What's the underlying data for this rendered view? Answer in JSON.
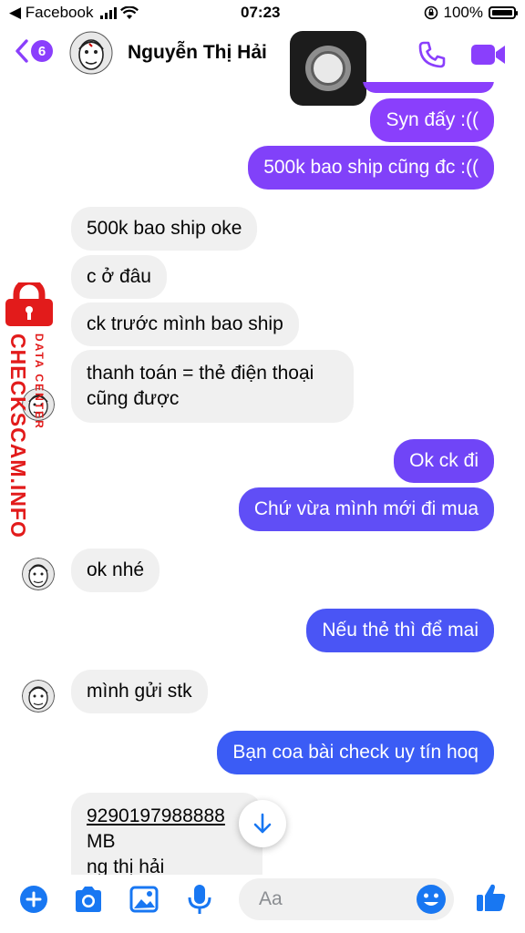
{
  "status_bar": {
    "back_app": "◀ Facebook",
    "time": "07:23",
    "battery": "100%"
  },
  "header": {
    "unread_count": "6",
    "contact_name": "Nguyễn Thị Hải"
  },
  "messages": [
    {
      "side": "out",
      "text": "Syn đấy :(("
    },
    {
      "side": "out",
      "text": "500k bao ship cũng đc :(("
    },
    {
      "side": "in",
      "text": "500k bao ship oke"
    },
    {
      "side": "in",
      "text": "c ở đâu"
    },
    {
      "side": "in",
      "text": "ck trước mình bao ship"
    },
    {
      "side": "in",
      "text_line1": "thanh toán = thẻ điện thoại",
      "text_line2": "cũng được"
    },
    {
      "side": "out",
      "text": "Ok ck đi"
    },
    {
      "side": "out",
      "text": "Chứ vừa mình mới đi mua"
    },
    {
      "side": "in",
      "text": "ok nhé"
    },
    {
      "side": "out",
      "text": "Nếu thẻ thì để mai"
    },
    {
      "side": "in",
      "text": "mình gửi stk"
    },
    {
      "side": "out",
      "text": "Bạn coa bài check uy tín hoq"
    },
    {
      "side": "in",
      "account_number": "9290197988888",
      "bank": "MB",
      "name_partial": "ng thị hải"
    }
  ],
  "watermark": {
    "brand": "CHECKSCAM.INFO",
    "tagline": "DATA CENTER"
  },
  "composer": {
    "placeholder": "Aa"
  },
  "colors": {
    "accent": "#8a3ffc",
    "bubble_purple": "#8a3ffc",
    "bubble_indigo": "#5b4ff5",
    "bubble_blue": "#3b5cf5",
    "incoming": "#f0f0f0"
  }
}
